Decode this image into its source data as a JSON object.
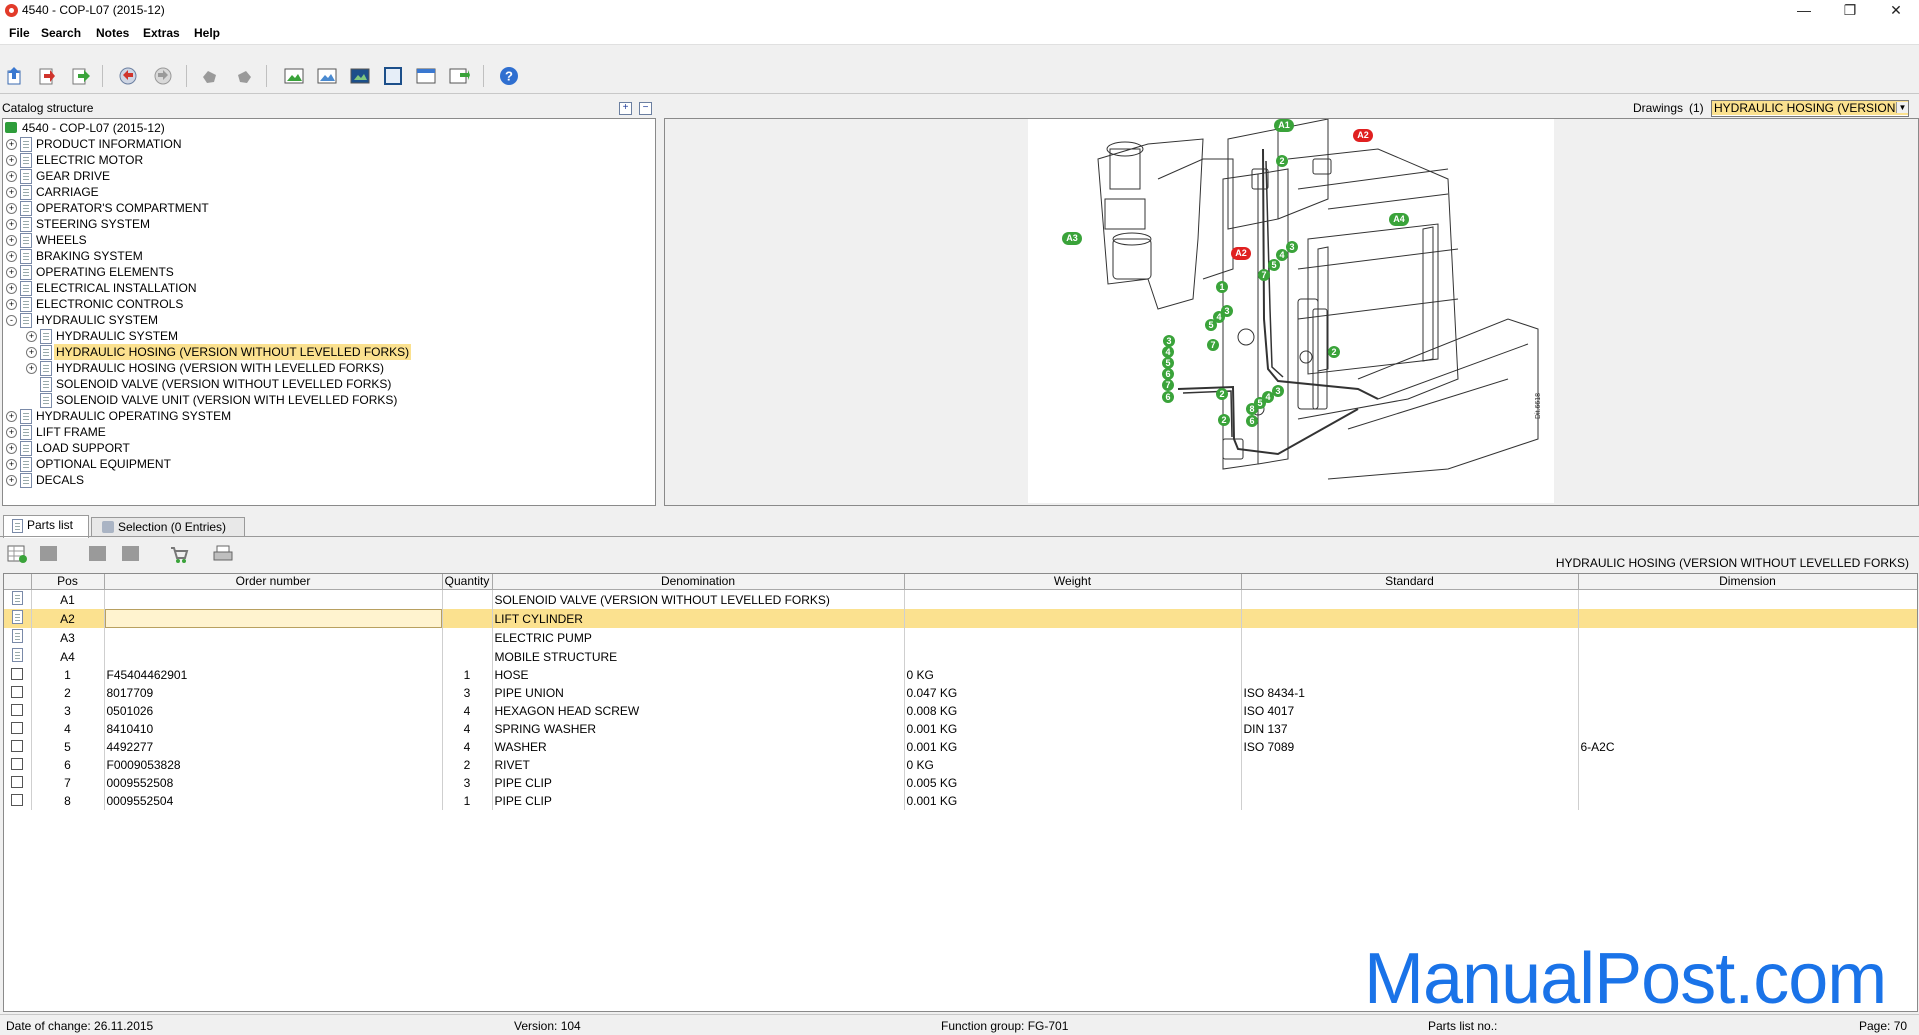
{
  "window": {
    "title": "4540 - COP-L07 (2015-12)",
    "controls": [
      "—",
      "❐",
      "✕"
    ]
  },
  "menu": [
    "File",
    "Search",
    "Notes",
    "Extras",
    "Help"
  ],
  "catalog": {
    "header": "Catalog structure",
    "root": "4540 - COP-L07 (2015-12)",
    "items": [
      {
        "label": "PRODUCT INFORMATION",
        "level": 1,
        "expander": "+"
      },
      {
        "label": "ELECTRIC MOTOR",
        "level": 1,
        "expander": "+"
      },
      {
        "label": "GEAR DRIVE",
        "level": 1,
        "expander": "+"
      },
      {
        "label": "CARRIAGE",
        "level": 1,
        "expander": "+"
      },
      {
        "label": "OPERATOR'S COMPARTMENT",
        "level": 1,
        "expander": "+"
      },
      {
        "label": "STEERING SYSTEM",
        "level": 1,
        "expander": "+"
      },
      {
        "label": "WHEELS",
        "level": 1,
        "expander": "+"
      },
      {
        "label": "BRAKING SYSTEM",
        "level": 1,
        "expander": "+"
      },
      {
        "label": "OPERATING ELEMENTS",
        "level": 1,
        "expander": "+"
      },
      {
        "label": "ELECTRICAL INSTALLATION",
        "level": 1,
        "expander": "+"
      },
      {
        "label": "ELECTRONIC CONTROLS",
        "level": 1,
        "expander": "+"
      },
      {
        "label": "HYDRAULIC SYSTEM",
        "level": 1,
        "expander": "-"
      },
      {
        "label": "HYDRAULIC SYSTEM",
        "level": 2,
        "expander": "+"
      },
      {
        "label": "HYDRAULIC HOSING (VERSION WITHOUT LEVELLED FORKS)",
        "level": 2,
        "expander": "+",
        "selected": true
      },
      {
        "label": "HYDRAULIC HOSING (VERSION WITH LEVELLED FORKS)",
        "level": 2,
        "expander": "+"
      },
      {
        "label": "SOLENOID VALVE (VERSION WITHOUT LEVELLED FORKS)",
        "level": 2,
        "expander": ""
      },
      {
        "label": "SOLENOID VALVE UNIT (VERSION WITH LEVELLED FORKS)",
        "level": 2,
        "expander": ""
      },
      {
        "label": "HYDRAULIC OPERATING SYSTEM",
        "level": 1,
        "expander": "+"
      },
      {
        "label": "LIFT FRAME",
        "level": 1,
        "expander": "+"
      },
      {
        "label": "LOAD SUPPORT",
        "level": 1,
        "expander": "+"
      },
      {
        "label": "OPTIONAL EQUIPMENT",
        "level": 1,
        "expander": "+"
      },
      {
        "label": "DECALS",
        "level": 1,
        "expander": "+"
      }
    ]
  },
  "drawings": {
    "label": "Drawings",
    "count": "(1)",
    "selected": "HYDRAULIC HOSING (VERSION ...",
    "code": "Dit.6618"
  },
  "tabs": [
    {
      "label": "Parts list"
    },
    {
      "label": "Selection (0 Entries)"
    }
  ],
  "parts": {
    "title": "HYDRAULIC HOSING (VERSION WITHOUT LEVELLED FORKS)",
    "columns": [
      "",
      "Pos",
      "Order number",
      "Quantity",
      "Denomination",
      "Weight",
      "Standard",
      "Dimension"
    ],
    "rows": [
      {
        "type": "doc",
        "pos": "A1",
        "order": "",
        "qty": "",
        "name": "SOLENOID VALVE (VERSION WITHOUT LEVELLED FORKS)",
        "weight": "",
        "standard": "",
        "dimension": ""
      },
      {
        "type": "doc",
        "pos": "A2",
        "order": "",
        "qty": "",
        "name": "LIFT CYLINDER",
        "weight": "",
        "standard": "",
        "dimension": "",
        "selected": true
      },
      {
        "type": "doc",
        "pos": "A3",
        "order": "",
        "qty": "",
        "name": "ELECTRIC PUMP",
        "weight": "",
        "standard": "",
        "dimension": ""
      },
      {
        "type": "doc",
        "pos": "A4",
        "order": "",
        "qty": "",
        "name": "MOBILE STRUCTURE",
        "weight": "",
        "standard": "",
        "dimension": ""
      },
      {
        "type": "check",
        "pos": "1",
        "order": "F45404462901",
        "qty": "1",
        "name": "HOSE",
        "weight": "0 KG",
        "standard": "",
        "dimension": ""
      },
      {
        "type": "check",
        "pos": "2",
        "order": "8017709",
        "qty": "3",
        "name": "PIPE UNION",
        "weight": "0.047 KG",
        "standard": "ISO 8434-1",
        "dimension": ""
      },
      {
        "type": "check",
        "pos": "3",
        "order": "0501026",
        "qty": "4",
        "name": "HEXAGON HEAD SCREW",
        "weight": "0.008 KG",
        "standard": "ISO 4017",
        "dimension": ""
      },
      {
        "type": "check",
        "pos": "4",
        "order": "8410410",
        "qty": "4",
        "name": "SPRING WASHER",
        "weight": "0.001 KG",
        "standard": "DIN 137",
        "dimension": ""
      },
      {
        "type": "check",
        "pos": "5",
        "order": "4492277",
        "qty": "4",
        "name": "WASHER",
        "weight": "0.001 KG",
        "standard": "ISO 7089",
        "dimension": "6-A2C"
      },
      {
        "type": "check",
        "pos": "6",
        "order": "F0009053828",
        "qty": "2",
        "name": "RIVET",
        "weight": "0 KG",
        "standard": "",
        "dimension": ""
      },
      {
        "type": "check",
        "pos": "7",
        "order": "0009552508",
        "qty": "3",
        "name": "PIPE CLIP",
        "weight": "0.005 KG",
        "standard": "",
        "dimension": ""
      },
      {
        "type": "check",
        "pos": "8",
        "order": "0009552504",
        "qty": "1",
        "name": "PIPE CLIP",
        "weight": "0.001 KG",
        "standard": "",
        "dimension": ""
      }
    ]
  },
  "status": {
    "date": "Date of change: 26.11.2015",
    "version": "Version: 104",
    "function_group": "Function group: FG-701",
    "parts_list_no": "Parts list no.:",
    "page": "Page: 70"
  },
  "watermark": "ManualPost.com",
  "callouts": {
    "A1": "A1",
    "A2": "A2",
    "A3": "A3",
    "A4": "A4",
    "n1": "1",
    "n2": "2",
    "n3": "3",
    "n4": "4",
    "n5": "5",
    "n6": "6",
    "n7": "7",
    "n8": "8"
  },
  "colors": {
    "selection": "#fbe18f",
    "accent_green": "#3aa33a",
    "accent_red": "#e02020",
    "watermark": "#1a73e8"
  }
}
